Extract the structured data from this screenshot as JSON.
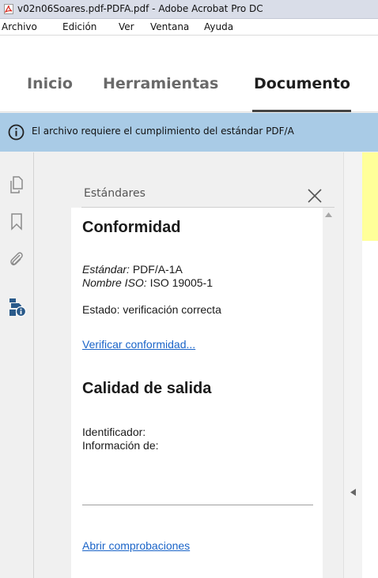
{
  "window": {
    "title": "v02n06Soares.pdf-PDFA.pdf - Adobe Acrobat Pro DC"
  },
  "menu": {
    "items": [
      "Archivo",
      "Edición",
      "Ver",
      "Ventana",
      "Ayuda"
    ]
  },
  "tabs": {
    "inicio": "Inicio",
    "herramientas": "Herramientas",
    "documento": "Documento",
    "active": "Documento"
  },
  "infobar": {
    "message": "El archivo requiere el cumplimiento del estándar PDF/A"
  },
  "rail": {
    "icons": [
      "pages-icon",
      "bookmark-icon",
      "attachment-icon",
      "standards-info-icon"
    ]
  },
  "panel": {
    "title": "Estándares",
    "heading_conformidad": "Conformidad",
    "estandar_label": "Estándar:",
    "estandar_value": "PDF/A-1A",
    "iso_label": "Nombre ISO:",
    "iso_value": "ISO 19005-1",
    "estado": "Estado: verificación correcta",
    "verificar_link": "Verificar conformidad...",
    "heading_calidad": "Calidad de salida",
    "identificador": "Identificador:",
    "informacion": "Información de:",
    "abrir_link": "Abrir comprobaciones"
  },
  "colors": {
    "infobar_bg": "#a9cbe6",
    "link": "#1a64c8",
    "doc_highlight": "#ffff99",
    "pdf_icon_red": "#d9261c"
  }
}
